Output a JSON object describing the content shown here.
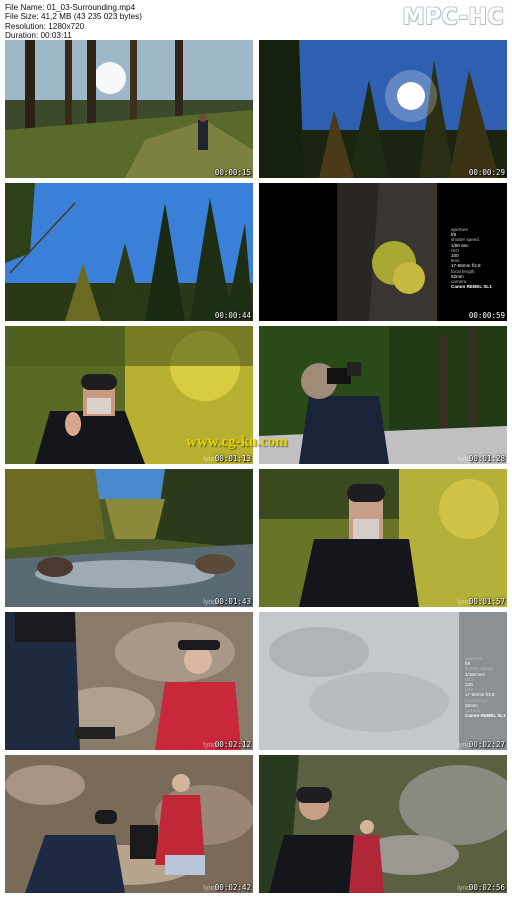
{
  "file_info": {
    "file_name": "File Name: 01_03-Surrounding.mp4",
    "file_size": "File Size: 41,2 MB (43 235 023 bytes)",
    "resolution": "Resolution: 1280x720",
    "duration": "Duration: 00:03:11"
  },
  "logo": "MPC-HC",
  "watermark": "www.cg-ku.com",
  "thumbnails": [
    {
      "timestamp": "00:00:15",
      "scene": "forest-sun-hiker"
    },
    {
      "timestamp": "00:00:29",
      "scene": "trees-sunburst"
    },
    {
      "timestamp": "00:00:44",
      "scene": "pines-blue-sky"
    },
    {
      "timestamp": "00:00:59",
      "scene": "cliff-camera-settings"
    },
    {
      "timestamp": "00:01:13",
      "scene": "man-gesturing-aspens"
    },
    {
      "timestamp": "00:01:28",
      "scene": "man-with-camera"
    },
    {
      "timestamp": "00:01:43",
      "scene": "mountain-stream"
    },
    {
      "timestamp": "00:01:57",
      "scene": "man-portrait-aspens"
    },
    {
      "timestamp": "00:02:12",
      "scene": "woman-red-jacket"
    },
    {
      "timestamp": "00:02:27",
      "scene": "faded-camera-settings"
    },
    {
      "timestamp": "00:02:42",
      "scene": "photographer-and-model"
    },
    {
      "timestamp": "00:02:56",
      "scene": "man-on-rocks"
    }
  ],
  "lynda_label": "lynda",
  "camera_settings_1": {
    "items": [
      {
        "label": "aperture",
        "value": "f/8"
      },
      {
        "label": "shutter speed",
        "value": "1/80 sec"
      },
      {
        "label": "ISO",
        "value": "100"
      },
      {
        "label": "lens",
        "value": "17-55mm f/2.8"
      },
      {
        "label": "focal length",
        "value": "52mm"
      },
      {
        "label": "camera",
        "value": "Canon REBEL SL1"
      }
    ]
  },
  "camera_settings_2": {
    "items": [
      {
        "label": "aperture",
        "value": "f/8"
      },
      {
        "label": "shutter speed",
        "value": "1/160 sec"
      },
      {
        "label": "ISO",
        "value": "100"
      },
      {
        "label": "lens",
        "value": "17-55mm f/2.8"
      },
      {
        "label": "focal length",
        "value": "55mm"
      },
      {
        "label": "camera",
        "value": "Canon REBEL SL1"
      }
    ]
  }
}
